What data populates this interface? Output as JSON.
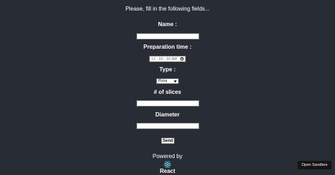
{
  "form": {
    "intro": "Please, fill in the following fields...",
    "name_label": "Name :",
    "name_value": "",
    "prep_label": "Preparation time :",
    "prep_value": "12 : 00 : 00   AM",
    "type_label": "Type :",
    "type_selected": "Pizza",
    "slices_label": "# of slices",
    "slices_value": "",
    "diameter_label": "Diameter",
    "diameter_value": "",
    "send_label": "Send"
  },
  "footer": {
    "powered_by": "Powered by",
    "react_label": "React",
    "react_logo_color": "#61dafb"
  },
  "sandbox": {
    "label": "Open Sandbox"
  },
  "icons": {
    "time": "clock-icon",
    "select": "chevron-down-icon",
    "react": "react-logo-icon"
  },
  "colors": {
    "background": "#282c34",
    "text": "#ffffff"
  }
}
